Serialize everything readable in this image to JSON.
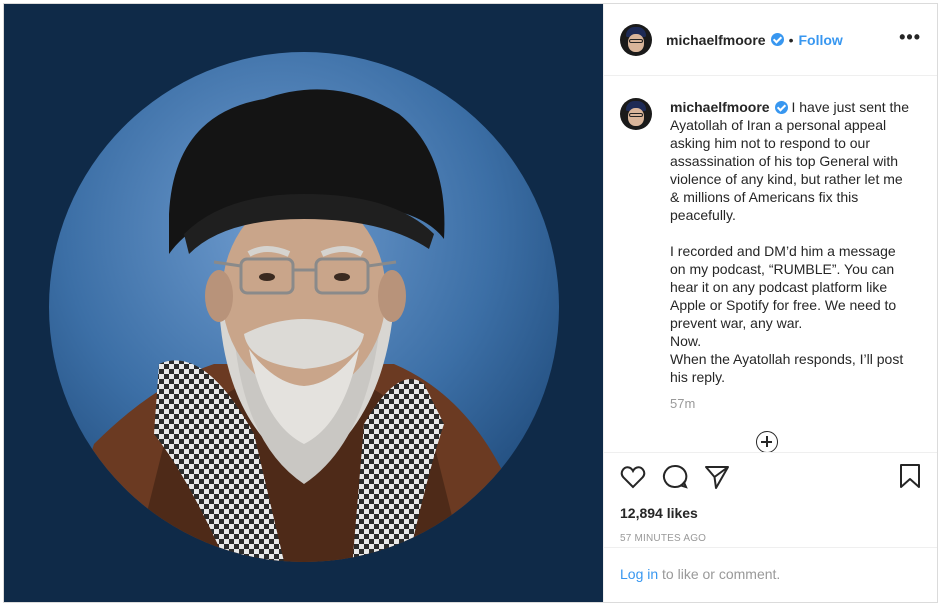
{
  "header": {
    "username": "michaelfmoore",
    "separator": "•",
    "follow_label": "Follow",
    "more_label": "•••"
  },
  "caption": {
    "username": "michaelfmoore",
    "text": "I have just sent the Ayatollah of Iran a personal appeal asking him not to respond to our assassination of his top General with violence of any kind, but rather let me & millions of Americans fix this peacefully.\n\nI recorded and DM’d him a message on my podcast, “RUMBLE”. You can hear it on any podcast platform like Apple or Spotify for free. We need to prevent war, any war.\nNow.\nWhen the Ayatollah responds, I’ll post his reply.",
    "time": "57m"
  },
  "engagement": {
    "likes": "12,894 likes",
    "posted_ago": "57 MINUTES AGO"
  },
  "login": {
    "link": "Log in",
    "rest": " to like or comment."
  },
  "colors": {
    "link_blue": "#3897f0",
    "media_background": "#0f2a48",
    "verified": "#3897f0"
  },
  "icons": [
    "heart-icon",
    "comment-icon",
    "share-icon",
    "bookmark-icon",
    "verified-icon",
    "more-icon",
    "plus-circle-icon"
  ]
}
